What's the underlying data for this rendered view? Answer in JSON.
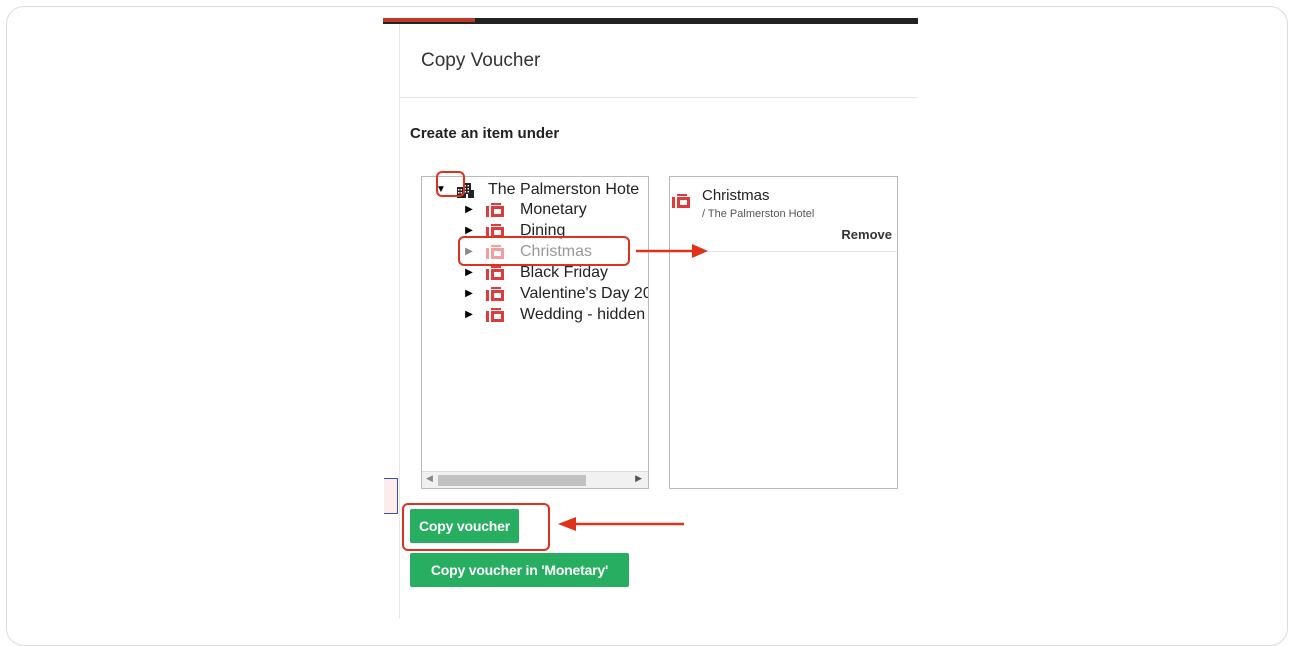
{
  "dialog": {
    "title": "Copy Voucher",
    "subtitle": "Create an item under"
  },
  "tree": {
    "root": {
      "label": "The Palmerston Hote",
      "icon": "hotel-building-icon",
      "expanded": true
    },
    "items": [
      {
        "label": "Monetary",
        "icon": "voucher-icon"
      },
      {
        "label": "Dining",
        "icon": "voucher-icon"
      },
      {
        "label": "Christmas",
        "icon": "voucher-icon",
        "selected": true
      },
      {
        "label": "Black Friday",
        "icon": "voucher-icon"
      },
      {
        "label": "Valentine's Day 20",
        "icon": "voucher-icon"
      },
      {
        "label": "Wedding - hidden",
        "icon": "voucher-icon"
      }
    ]
  },
  "selection": {
    "name": "Christmas",
    "path": "/ The Palmerston Hotel",
    "remove_label": "Remove"
  },
  "actions": {
    "copy_label": "Copy voucher",
    "copy_in_label": "Copy voucher in 'Monetary'"
  },
  "colors": {
    "accent_green": "#27ae60",
    "voucher_red": "#e03a3a",
    "annotation_red": "#e0321b",
    "topbar": "#222222"
  }
}
